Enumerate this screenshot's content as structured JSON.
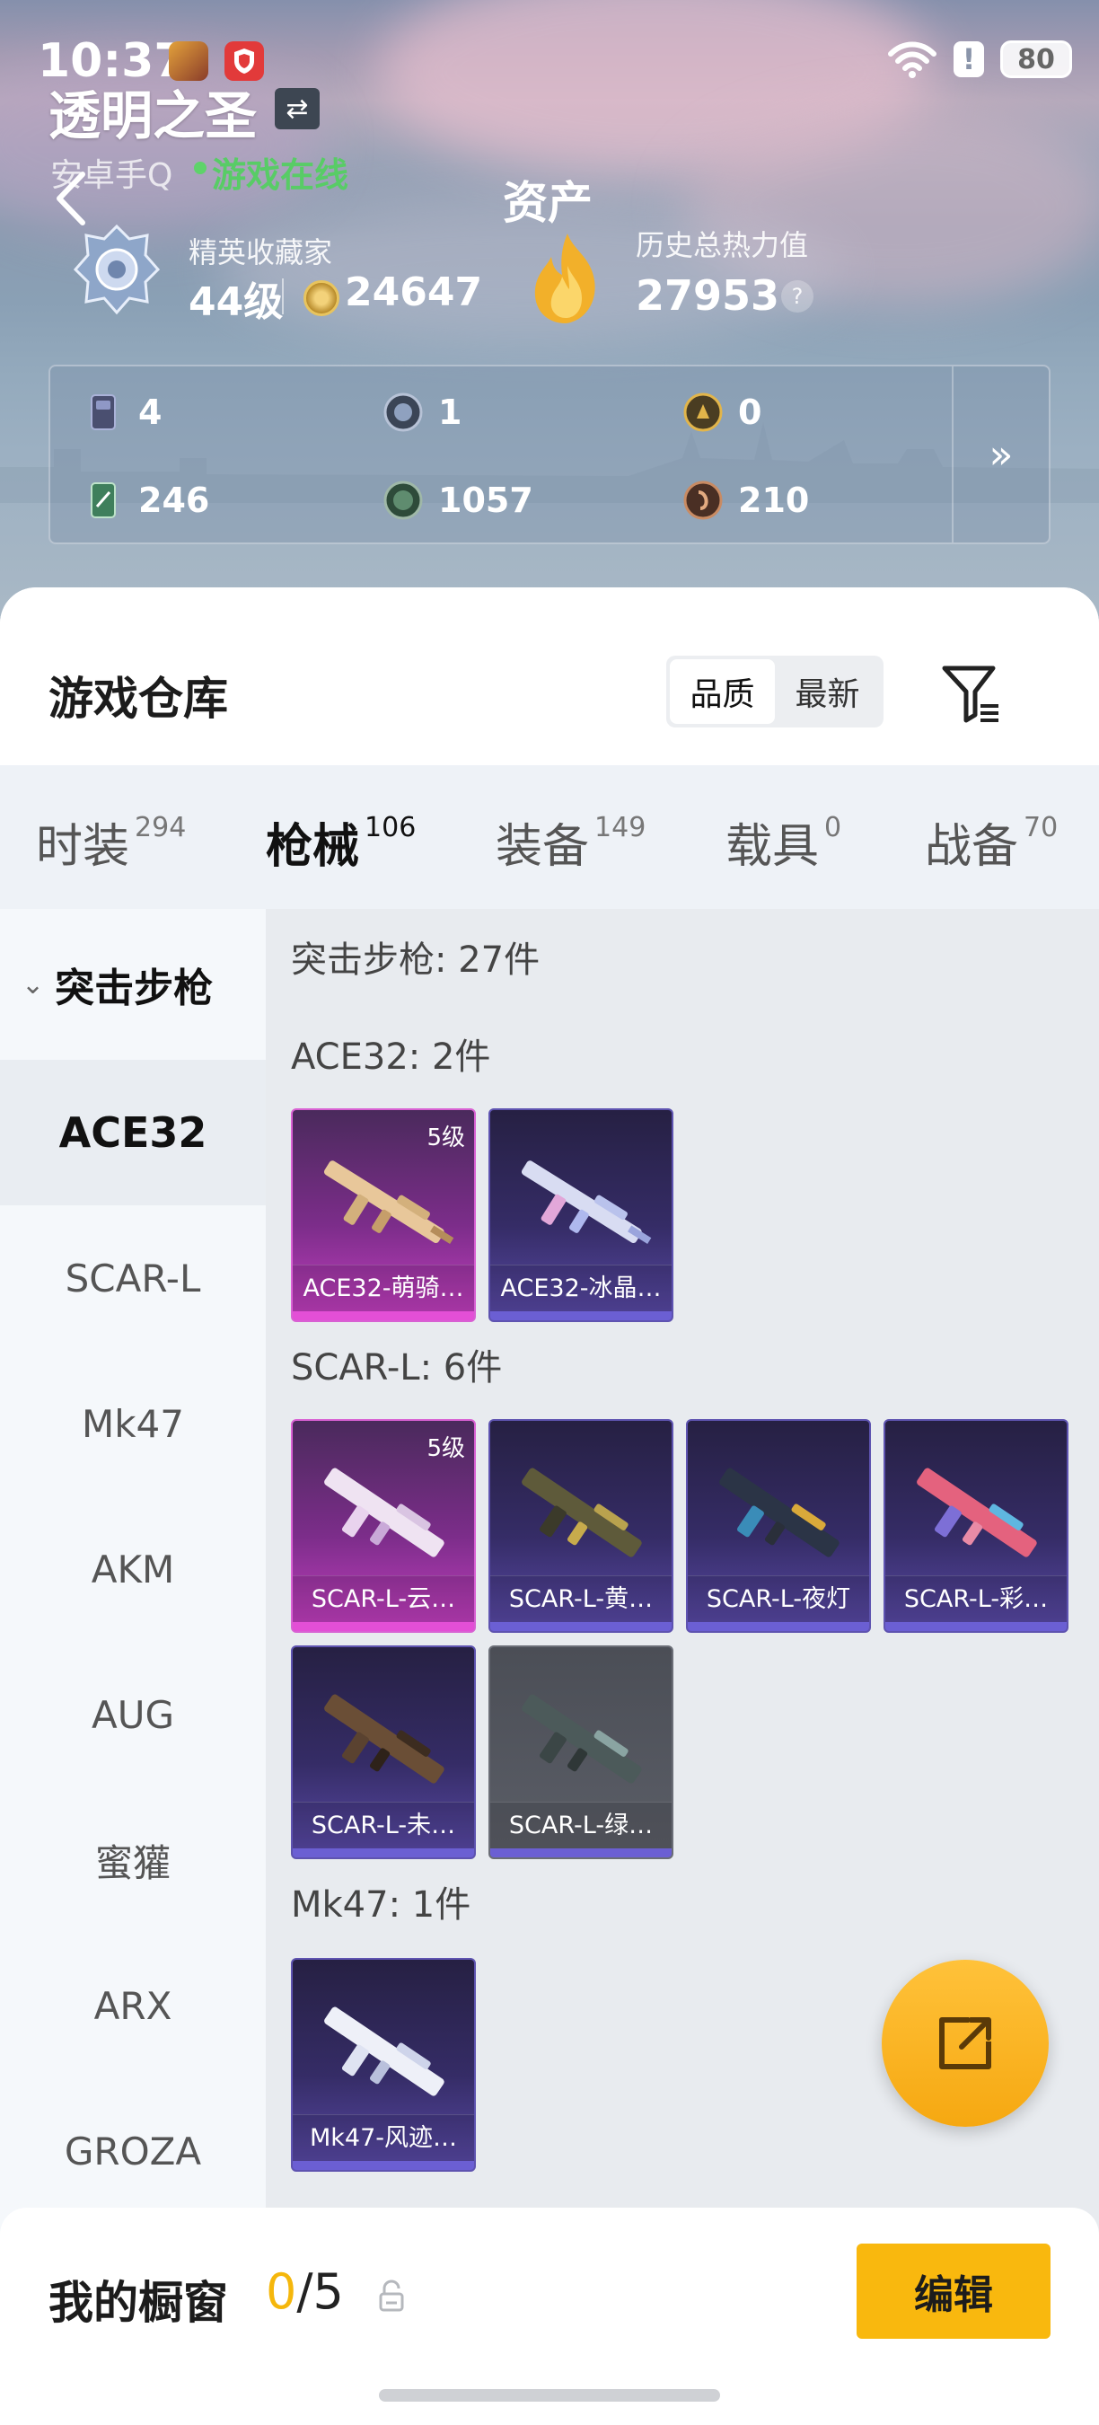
{
  "status_bar": {
    "time": "10:37",
    "battery": "80"
  },
  "profile": {
    "name": "透明之圣",
    "platform": "安卓手Q",
    "online_status": "游戏在线"
  },
  "page_title": "资产",
  "collector": {
    "title": "精英收藏家",
    "level": "44级",
    "points": "24647"
  },
  "heat": {
    "title": "历史总热力值",
    "value": "27953",
    "help": "?"
  },
  "resources": [
    {
      "icon": "card-icon",
      "value": "4"
    },
    {
      "icon": "silver-coin-icon",
      "value": "1"
    },
    {
      "icon": "gold-coin-icon",
      "value": "0"
    },
    {
      "icon": "ticket-icon",
      "value": "246"
    },
    {
      "icon": "green-orb-icon",
      "value": "1057"
    },
    {
      "icon": "bronze-coin-icon",
      "value": "210"
    }
  ],
  "resources_more": "»",
  "warehouse": {
    "title": "游戏仓库",
    "sort": {
      "quality": "品质",
      "newest": "最新"
    }
  },
  "tabs": [
    {
      "label": "时装",
      "count": "294"
    },
    {
      "label": "枪械",
      "count": "106",
      "active": true
    },
    {
      "label": "装备",
      "count": "149"
    },
    {
      "label": "载具",
      "count": "0"
    },
    {
      "label": "战备",
      "count": "70"
    }
  ],
  "sidebar": {
    "header": "突击步枪",
    "items": [
      "ACE32",
      "SCAR-L",
      "Mk47",
      "AKM",
      "AUG",
      "蜜獾",
      "ARX",
      "GROZA"
    ],
    "active": "ACE32"
  },
  "content": {
    "summary": "突击步枪: 27件",
    "groups": [
      {
        "title": "ACE32: 2件",
        "items": [
          {
            "name": "ACE32-萌骑…",
            "level": "5级",
            "rarity": "pink"
          },
          {
            "name": "ACE32-冰晶…",
            "rarity": "purple"
          }
        ]
      },
      {
        "title": "SCAR-L: 6件",
        "items": [
          {
            "name": "SCAR-L-云…",
            "level": "5级",
            "rarity": "pink"
          },
          {
            "name": "SCAR-L-黄…",
            "rarity": "purple"
          },
          {
            "name": "SCAR-L-夜灯",
            "rarity": "purple"
          },
          {
            "name": "SCAR-L-彩…",
            "rarity": "purple"
          },
          {
            "name": "SCAR-L-未…",
            "rarity": "purple"
          },
          {
            "name": "SCAR-L-绿…",
            "rarity": "grey"
          }
        ]
      },
      {
        "title": "Mk47: 1件",
        "items": [
          {
            "name": "Mk47-风迹…",
            "rarity": "purple"
          }
        ]
      }
    ]
  },
  "showcase": {
    "title": "我的橱窗",
    "used": "0",
    "total": "/5",
    "edit": "编辑"
  },
  "colors": {
    "accent": "#f5b70c",
    "online": "#58cc66",
    "pink_rarity": "#d861d3",
    "purple_rarity": "#5e53b0"
  }
}
